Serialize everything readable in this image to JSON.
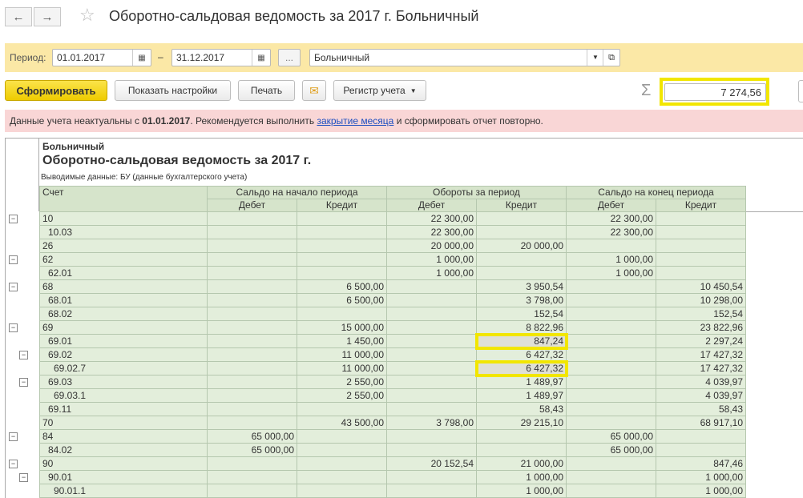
{
  "nav": {
    "back": "←",
    "forward": "→",
    "star": "☆"
  },
  "title": "Оборотно-сальдовая ведомость за 2017 г. Больничный",
  "period": {
    "label": "Период:",
    "from": "01.01.2017",
    "dash": "–",
    "to": "31.12.2017",
    "more": "...",
    "org": "Больничный"
  },
  "toolbar": {
    "generate": "Сформировать",
    "settings": "Показать настройки",
    "print": "Печать",
    "register": "Регистр учета",
    "sum_symbol": "Σ",
    "sum": "7 274,56"
  },
  "warning": {
    "p1": "Данные учета неактуальны с ",
    "date": "01.01.2017",
    "p2": ". Рекомендуется выполнить ",
    "link": "закрытие месяца",
    "p3": " и сформировать отчет повторно."
  },
  "report": {
    "org": "Больничный",
    "title": "Оборотно-сальдовая ведомость за 2017 г.",
    "subtitle": "Выводимые данные:  БУ (данные бухгалтерского учета)",
    "headers": {
      "account": "Счет",
      "start": "Сальдо на начало периода",
      "turnover": "Обороты за период",
      "end": "Сальдо на конец периода",
      "debit": "Дебет",
      "credit": "Кредит"
    },
    "rows": [
      {
        "acc": "10",
        "lvl": 0,
        "exp": 1,
        "v": [
          "",
          "",
          "22 300,00",
          "",
          "22 300,00",
          ""
        ]
      },
      {
        "acc": "10.03",
        "lvl": 1,
        "v": [
          "",
          "",
          "22 300,00",
          "",
          "22 300,00",
          ""
        ]
      },
      {
        "acc": "26",
        "lvl": 0,
        "v": [
          "",
          "",
          "20 000,00",
          "20 000,00",
          "",
          ""
        ]
      },
      {
        "acc": "62",
        "lvl": 0,
        "exp": 1,
        "v": [
          "",
          "",
          "1 000,00",
          "",
          "1 000,00",
          ""
        ]
      },
      {
        "acc": "62.01",
        "lvl": 1,
        "v": [
          "",
          "",
          "1 000,00",
          "",
          "1 000,00",
          ""
        ]
      },
      {
        "acc": "68",
        "lvl": 0,
        "exp": 1,
        "v": [
          "",
          "6 500,00",
          "",
          "3 950,54",
          "",
          "10 450,54"
        ]
      },
      {
        "acc": "68.01",
        "lvl": 1,
        "v": [
          "",
          "6 500,00",
          "",
          "3 798,00",
          "",
          "10 298,00"
        ]
      },
      {
        "acc": "68.02",
        "lvl": 1,
        "v": [
          "",
          "",
          "",
          "152,54",
          "",
          "152,54"
        ]
      },
      {
        "acc": "69",
        "lvl": 0,
        "exp": 1,
        "v": [
          "",
          "15 000,00",
          "",
          "8 822,96",
          "",
          "23 822,96"
        ]
      },
      {
        "acc": "69.01",
        "lvl": 1,
        "hl": 3,
        "v": [
          "",
          "1 450,00",
          "",
          "847,24",
          "",
          "2 297,24"
        ]
      },
      {
        "acc": "69.02",
        "lvl": 1,
        "exp": 1,
        "v": [
          "",
          "11 000,00",
          "",
          "6 427,32",
          "",
          "17 427,32"
        ]
      },
      {
        "acc": "69.02.7",
        "lvl": 2,
        "hl": 3,
        "v": [
          "",
          "11 000,00",
          "",
          "6 427,32",
          "",
          "17 427,32"
        ]
      },
      {
        "acc": "69.03",
        "lvl": 1,
        "exp": 1,
        "v": [
          "",
          "2 550,00",
          "",
          "1 489,97",
          "",
          "4 039,97"
        ]
      },
      {
        "acc": "69.03.1",
        "lvl": 2,
        "v": [
          "",
          "2 550,00",
          "",
          "1 489,97",
          "",
          "4 039,97"
        ]
      },
      {
        "acc": "69.11",
        "lvl": 1,
        "v": [
          "",
          "",
          "",
          "58,43",
          "",
          "58,43"
        ]
      },
      {
        "acc": "70",
        "lvl": 0,
        "v": [
          "",
          "43 500,00",
          "3 798,00",
          "29 215,10",
          "",
          "68 917,10"
        ]
      },
      {
        "acc": "84",
        "lvl": 0,
        "exp": 1,
        "v": [
          "65 000,00",
          "",
          "",
          "",
          "65 000,00",
          ""
        ]
      },
      {
        "acc": "84.02",
        "lvl": 1,
        "v": [
          "65 000,00",
          "",
          "",
          "",
          "65 000,00",
          ""
        ]
      },
      {
        "acc": "90",
        "lvl": 0,
        "exp": 1,
        "v": [
          "",
          "",
          "20 152,54",
          "21 000,00",
          "",
          "847,46"
        ]
      },
      {
        "acc": "90.01",
        "lvl": 1,
        "exp": 1,
        "v": [
          "",
          "",
          "",
          "1 000,00",
          "",
          "1 000,00"
        ]
      },
      {
        "acc": "90.01.1",
        "lvl": 2,
        "v": [
          "",
          "",
          "",
          "1 000,00",
          "",
          "1 000,00"
        ]
      }
    ]
  },
  "colors": {
    "highlight": "#f2e600",
    "period_bg": "#fbe8a6",
    "warn_bg": "#f9d6d6",
    "cell_bg": "#e3eedb",
    "generate_bg": "#f5d800"
  }
}
